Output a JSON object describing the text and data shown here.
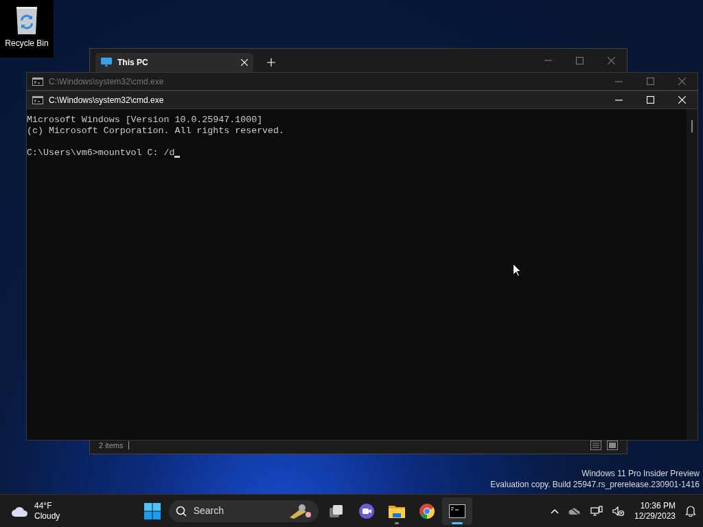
{
  "desktop_icons": [
    {
      "label": "Recycle Bin",
      "selected": true
    }
  ],
  "explorer": {
    "tab_title": "This PC",
    "status": "2 items"
  },
  "cmd_windows": [
    {
      "title": "C:\\Windows\\system32\\cmd.exe",
      "active": false
    },
    {
      "title": "C:\\Windows\\system32\\cmd.exe",
      "active": true
    }
  ],
  "console": {
    "lines": [
      "Microsoft Windows [Version 10.0.25947.1000]",
      "(c) Microsoft Corporation. All rights reserved."
    ],
    "prompt": "C:\\Users\\vm6>mountvol C: /d"
  },
  "build_info": [
    "Windows 11 Pro Insider Preview",
    "Evaluation copy. Build 25947.rs_prerelease.230901-1416"
  ],
  "taskbar": {
    "weather": {
      "temperature": "44°F",
      "condition": "Cloudy"
    },
    "search": {
      "placeholder": "Search"
    },
    "apps": [
      {
        "kind": "taskview",
        "running": false,
        "active": false
      },
      {
        "kind": "meet",
        "running": false,
        "active": false
      },
      {
        "kind": "folder",
        "running": true,
        "active": false
      },
      {
        "kind": "browser",
        "running": false,
        "active": false
      },
      {
        "kind": "terminal",
        "running": true,
        "active": true
      }
    ],
    "clock": {
      "time": "10:36 PM",
      "date": "12/29/2023"
    }
  }
}
